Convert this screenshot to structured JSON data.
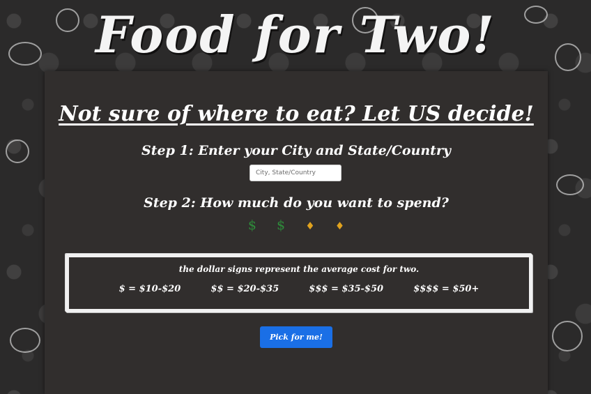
{
  "site": {
    "title": "Food for Two!"
  },
  "main": {
    "tagline": "Not sure of where to eat? Let US decide!",
    "step1": "Step 1: Enter your City and State/Country",
    "city_input": {
      "placeholder": "City, State/Country",
      "value": ""
    },
    "step2": "Step 2: How much do you want to spend?",
    "rating": {
      "selected": 2,
      "max": 4,
      "selected_symbol": "$",
      "unselected_symbol": "♦"
    },
    "legend": {
      "caption": "the dollar signs represent the average cost for two.",
      "items": [
        "$ = $10-$20",
        "$$ = $20-$35",
        "$$$ = $35-$50",
        "$$$$ = $50+"
      ]
    },
    "pick_button": "Pick for me!"
  },
  "colors": {
    "background": "#2b2a2a",
    "panel": "#312e2d",
    "dollar_selected": "#2e8b3a",
    "diamond_unselected": "#e0a21e",
    "button": "#1a6fe6"
  }
}
